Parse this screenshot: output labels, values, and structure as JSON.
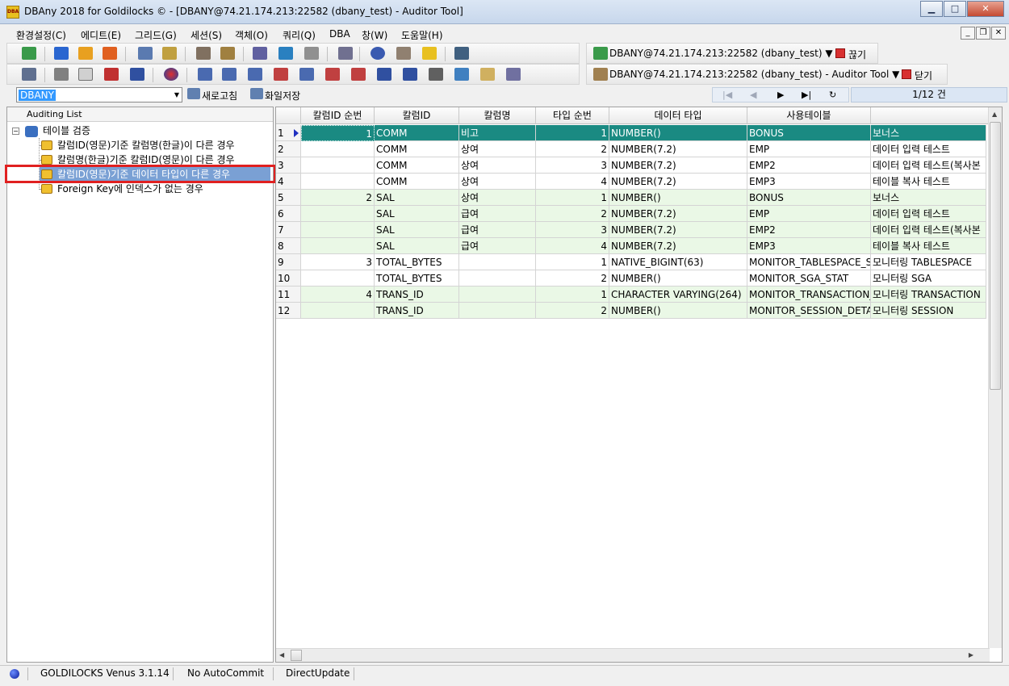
{
  "window": {
    "title": "DBAny 2018 for Goldilocks © - [DBANY@74.21.174.213:22582 (dbany_test) - Auditor Tool]",
    "app_icon_label": "DBA"
  },
  "menu": [
    "환경설정(C)",
    "에디트(E)",
    "그리드(G)",
    "세션(S)",
    "객체(O)",
    "쿼리(Q)",
    "DBA",
    "창(W)",
    "도움말(H)"
  ],
  "connections": {
    "primary": "DBANY@74.21.174.213:22582 (dbany_test) ▼",
    "primary_action": "끊기",
    "secondary": "DBANY@74.21.174.213:22582 (dbany_test) - Auditor Tool ▼",
    "secondary_action": "닫기"
  },
  "toolbar3": {
    "combo_value": "DBANY",
    "refresh_label": "새로고침",
    "save_file_label": "화일저장",
    "page_info": "1/12 건"
  },
  "tree": {
    "header": "Auditing List",
    "root": "테이블 검증",
    "items": [
      "칼럼ID(영문)기준 칼럼명(한글)이 다른 경우",
      "칼럼명(한글)기준 칼럼ID(영문)이 다른 경우",
      "칼럼ID(영문)기준 데이터 타입이 다른 경우",
      "Foreign Key에 인덱스가 없는 경우"
    ],
    "selected_index": 2
  },
  "grid": {
    "columns": [
      "칼럼ID 순번",
      "칼럼ID",
      "칼럼명",
      "타입 순번",
      "데이터 타입",
      "사용테이블",
      ""
    ],
    "rows": [
      [
        "1",
        "1",
        "COMM",
        "비고",
        "1",
        "NUMBER()",
        "BONUS",
        "보너스"
      ],
      [
        "2",
        "",
        "COMM",
        "상여",
        "2",
        "NUMBER(7.2)",
        "EMP",
        "데이터 입력 테스트"
      ],
      [
        "3",
        "",
        "COMM",
        "상여",
        "3",
        "NUMBER(7.2)",
        "EMP2",
        "데이터 입력 테스트(복사본"
      ],
      [
        "4",
        "",
        "COMM",
        "상여",
        "4",
        "NUMBER(7.2)",
        "EMP3",
        "테이블 복사 테스트"
      ],
      [
        "5",
        "2",
        "SAL",
        "상여",
        "1",
        "NUMBER()",
        "BONUS",
        "보너스"
      ],
      [
        "6",
        "",
        "SAL",
        "급여",
        "2",
        "NUMBER(7.2)",
        "EMP",
        "데이터 입력 테스트"
      ],
      [
        "7",
        "",
        "SAL",
        "급여",
        "3",
        "NUMBER(7.2)",
        "EMP2",
        "데이터 입력 테스트(복사본"
      ],
      [
        "8",
        "",
        "SAL",
        "급여",
        "4",
        "NUMBER(7.2)",
        "EMP3",
        "테이블 복사 테스트"
      ],
      [
        "9",
        "3",
        "TOTAL_BYTES",
        "",
        "1",
        "NATIVE_BIGINT(63)",
        "MONITOR_TABLESPACE_STAT",
        "모니터링 TABLESPACE"
      ],
      [
        "10",
        "",
        "TOTAL_BYTES",
        "",
        "2",
        "NUMBER()",
        "MONITOR_SGA_STAT",
        "모니터링 SGA"
      ],
      [
        "11",
        "4",
        "TRANS_ID",
        "",
        "1",
        "CHARACTER VARYING(264)",
        "MONITOR_TRANSACTION_D",
        "모니터링 TRANSACTION"
      ],
      [
        "12",
        "",
        "TRANS_ID",
        "",
        "2",
        "NUMBER()",
        "MONITOR_SESSION_DETAIL",
        "모니터링 SESSION"
      ]
    ]
  },
  "status": {
    "server": "GOLDILOCKS Venus 3.1.14",
    "commit": "No AutoCommit",
    "update": "DirectUpdate"
  }
}
